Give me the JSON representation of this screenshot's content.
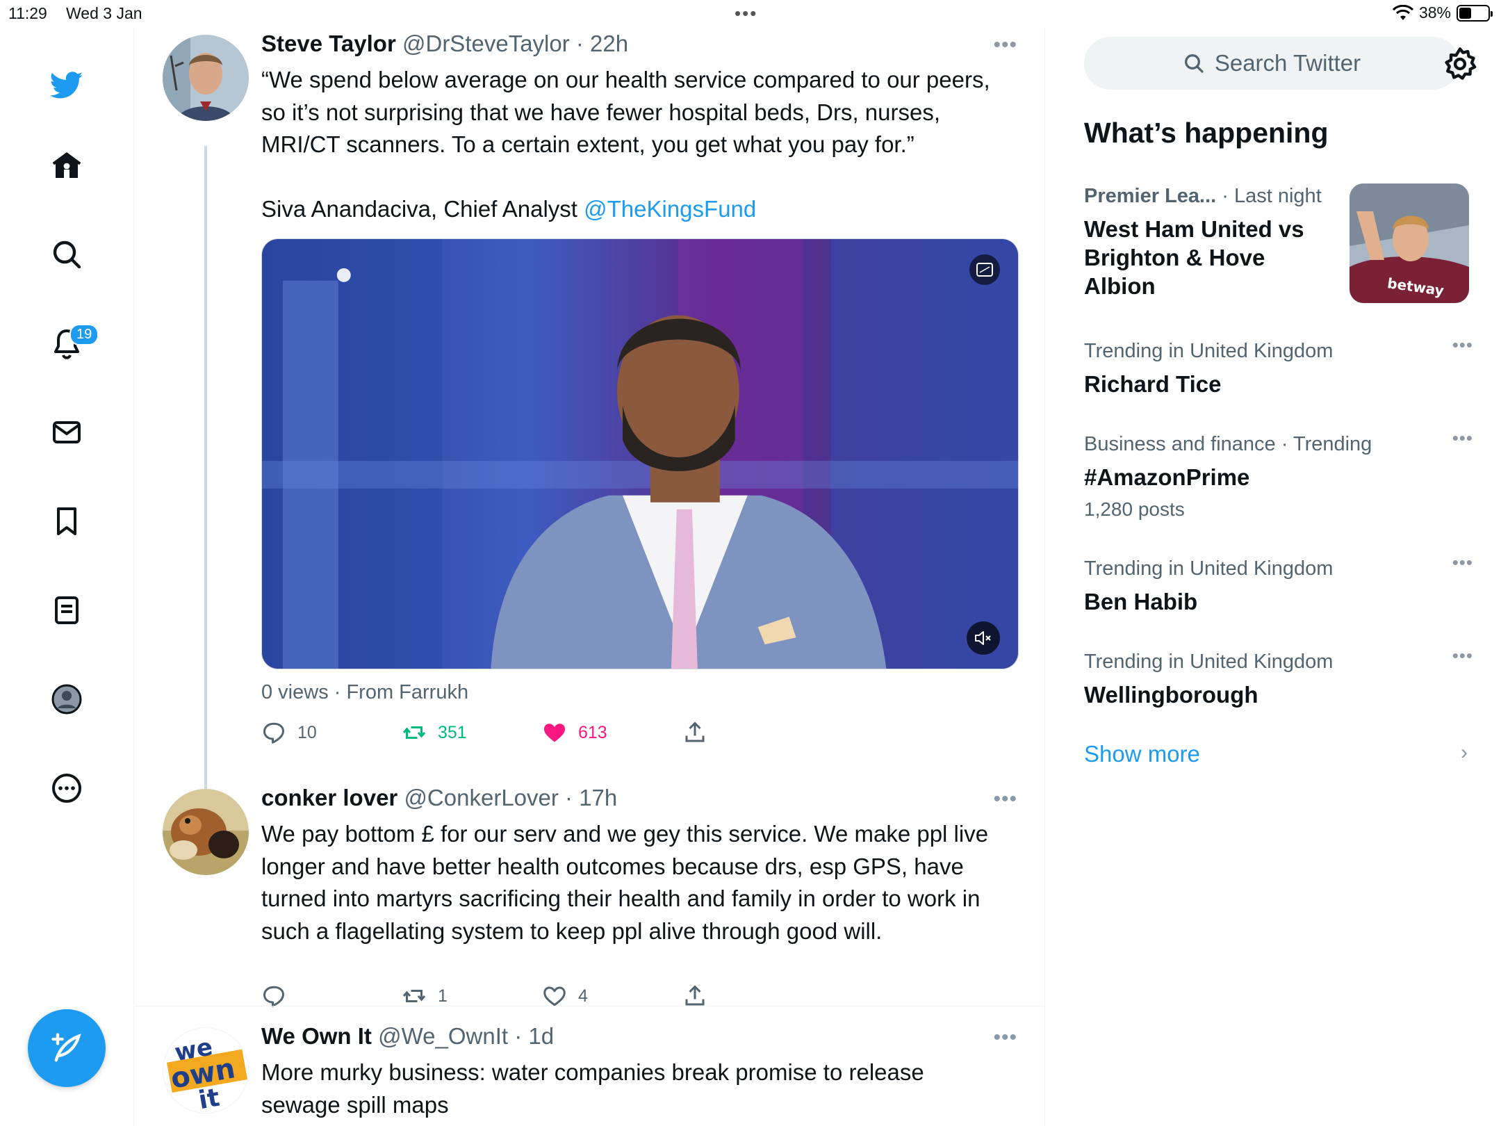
{
  "status_bar": {
    "time": "11:29",
    "date": "Wed 3 Jan",
    "battery": "38%",
    "battery_level": 0.38
  },
  "nav": {
    "notifications_badge": "19"
  },
  "tweets": [
    {
      "name": "Steve Taylor",
      "handle": "@DrSteveTaylor",
      "time": "· 22h",
      "text_line1": "“We spend below average on our health service compared to our peers, so it’s not surprising that we have fewer hospital beds, Drs, nurses, MRI/CT scanners. To a certain extent, you get what you pay for.”",
      "text_line2": "Siva Anandaciva, Chief Analyst ",
      "mention": "@TheKingsFund",
      "video_meta": "0 views · From Farrukh",
      "replies": "10",
      "retweets": "351",
      "likes": "613"
    },
    {
      "name": "conker lover",
      "handle": "@ConkerLover",
      "time": "· 17h",
      "text": "We pay bottom £ for our serv and we gey this service. We make ppl live longer and have better health outcomes because drs, esp GPS, have turned into martyrs sacrificing their health and family in order to work in such a flagellating system to keep ppl alive through good will.",
      "replies": "",
      "retweets": "1",
      "likes": "4"
    },
    {
      "name": "We Own It",
      "handle": "@We_OwnIt",
      "time": "· 1d",
      "text": "More murky business: water companies break promise to release sewage spill maps",
      "avatar_text_1": "we",
      "avatar_text_2": "own",
      "avatar_text_3": "it"
    }
  ],
  "sidebar": {
    "search_placeholder": "Search Twitter",
    "section_title": "What’s happening",
    "trends": [
      {
        "category": "Premier Lea...",
        "extra": " · Last night",
        "title": "West Ham United vs Brighton & Hove Albion"
      },
      {
        "category": "Trending in United Kingdom",
        "title": "Richard Tice"
      },
      {
        "category": "Business and finance · Trending",
        "title": "#AmazonPrime",
        "sub": "1,280 posts"
      },
      {
        "category": "Trending in United Kingdom",
        "title": "Ben Habib"
      },
      {
        "category": "Trending in United Kingdom",
        "title": "Wellingborough"
      }
    ],
    "show_more": "Show more",
    "trend_image_text": "betway"
  },
  "colors": {
    "accent": "#1d9bf0",
    "retweet": "#00ba7c",
    "like": "#f91880",
    "secondary_text": "#536471"
  }
}
